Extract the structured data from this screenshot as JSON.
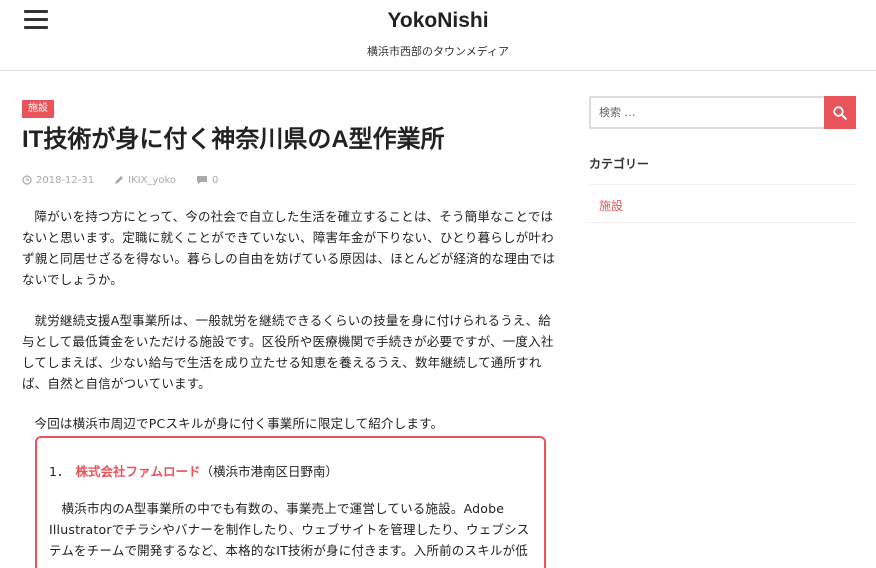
{
  "header": {
    "site_title": "YokoNishi",
    "site_description": "横浜市西部のタウンメディア"
  },
  "post": {
    "category": "施設",
    "title": "IT技術が身に付く神奈川県のA型作業所",
    "date": "2018-12-31",
    "author": "IKIX_yoko",
    "comments": "0",
    "paragraph1": "障がいを持つ方にとって、今の社会で自立した生活を確立することは、そう簡単なことではないと思います。定職に就くことができていない、障害年金が下りない、ひとり暮らしが叶わず親と同居せざるを得ない。暮らしの自由を妨げている原因は、ほとんどが経済的な理由ではないでしょうか。",
    "paragraph2": "就労継続支援A型事業所は、一般就労を継続できるくらいの技量を身に付けられるうえ、給与として最低賃金をいただける施設です。区役所や医療機関で手続きが必要ですが、一度入社してしまえば、少ない給与で生活を成り立たせる知恵を養えるうえ、数年継続して通所すれば、自然と自信がついています。",
    "paragraph3": "今回は横浜市周辺でPCスキルが身に付く事業所に限定して紹介します。"
  },
  "feature_box": {
    "number": "1．",
    "name": "株式会社ファムロード",
    "location": "（横浜市港南区日野南）",
    "text": "横浜市内のA型事業所の中でも有数の、事業売上で運営している施設。Adobe Illustratorでチラシやバナーを制作したり、ウェブサイトを管理したり、ウェブシステムをチームで開発するなど、本格的なIT技術が身に付きます。入所前のスキルが低"
  },
  "sidebar": {
    "search_placeholder": "検索 …",
    "categories_title": "カテゴリー",
    "categories": [
      "施設"
    ]
  },
  "colors": {
    "accent": "#e8545a",
    "meta": "#aaaaaa"
  },
  "icons": [
    "menu-icon",
    "clock-icon",
    "pencil-icon",
    "comment-icon",
    "search-icon"
  ]
}
